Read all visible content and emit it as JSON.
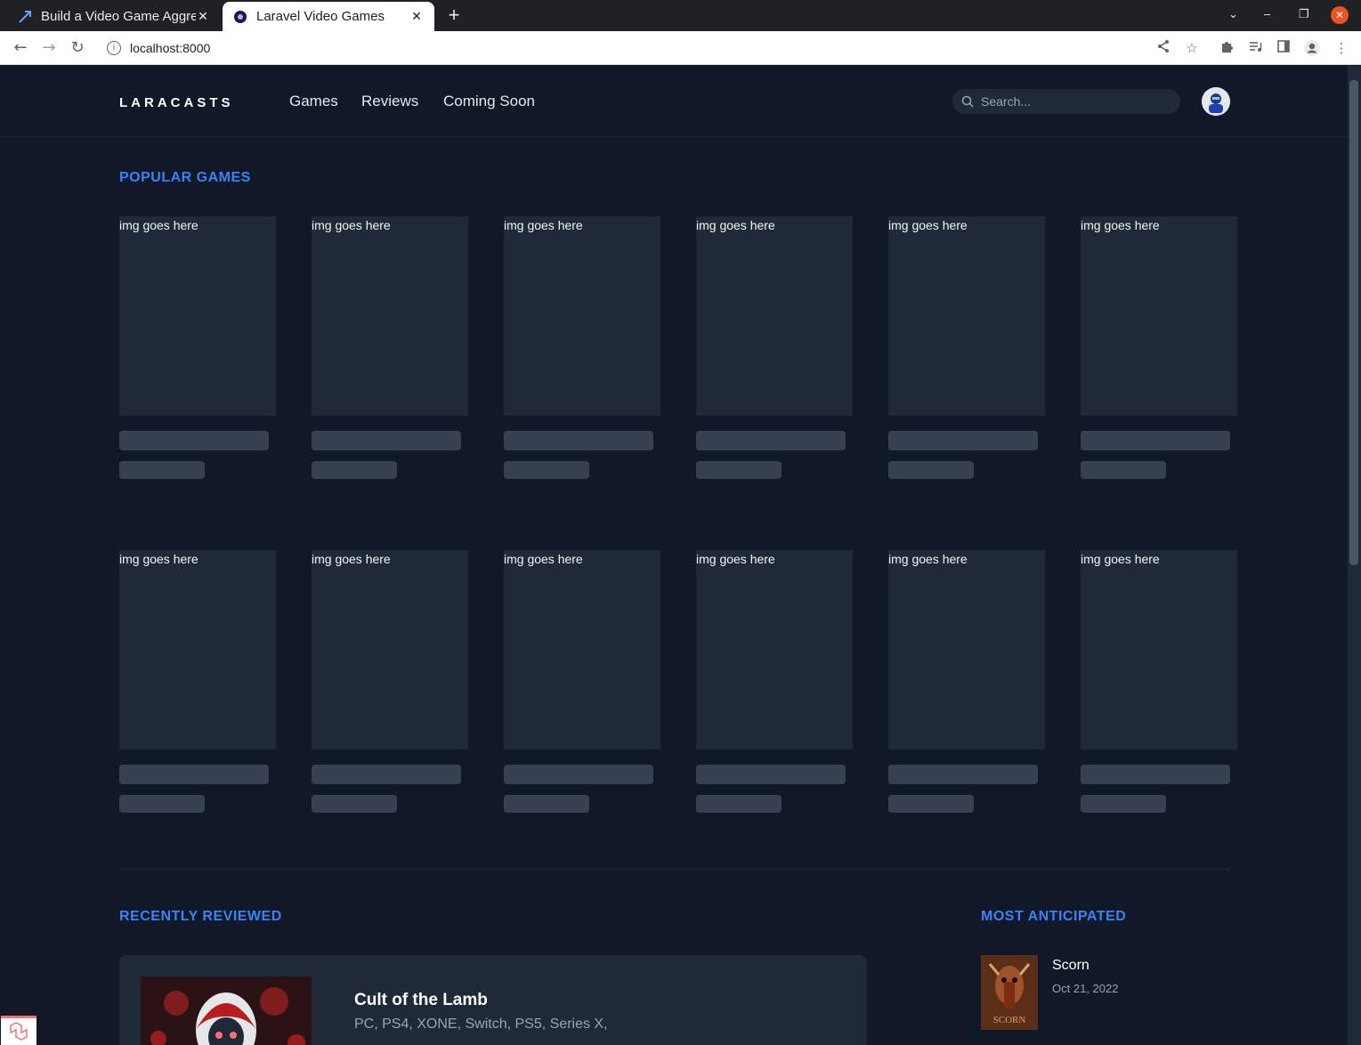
{
  "browser": {
    "tabs": [
      {
        "title": "Build a Video Game Aggre",
        "active": false
      },
      {
        "title": "Laravel Video Games",
        "active": true
      }
    ],
    "url": "localhost:8000",
    "new_tab_label": "+"
  },
  "site": {
    "logo": "LARACASTS",
    "nav": [
      "Games",
      "Reviews",
      "Coming Soon"
    ],
    "search_placeholder": "Search..."
  },
  "popular": {
    "title": "POPULAR GAMES",
    "placeholder_text": "img goes here",
    "cards": [
      "img goes here",
      "img goes here",
      "img goes here",
      "img goes here",
      "img goes here",
      "img goes here",
      "img goes here",
      "img goes here",
      "img goes here",
      "img goes here",
      "img goes here",
      "img goes here"
    ]
  },
  "recently_reviewed": {
    "title": "RECENTLY REVIEWED",
    "items": [
      {
        "name": "Cult of the Lamb",
        "platforms": "PC, PS4, XONE, Switch, PS5, Series X,"
      }
    ]
  },
  "most_anticipated": {
    "title": "MOST ANTICIPATED",
    "items": [
      {
        "name": "Scorn",
        "date": "Oct 21, 2022",
        "cover_text": "SCORN"
      }
    ]
  },
  "colors": {
    "accent": "#3b82f6",
    "page_bg": "#111827",
    "card_bg": "#1f2937",
    "skeleton": "#374151"
  },
  "icons": [
    "back-arrow-icon",
    "forward-arrow-icon",
    "reload-icon",
    "info-icon",
    "share-icon",
    "star-icon",
    "extensions-icon",
    "media-icon",
    "sidepanel-icon",
    "profile-icon",
    "menu-icon",
    "search-icon"
  ]
}
